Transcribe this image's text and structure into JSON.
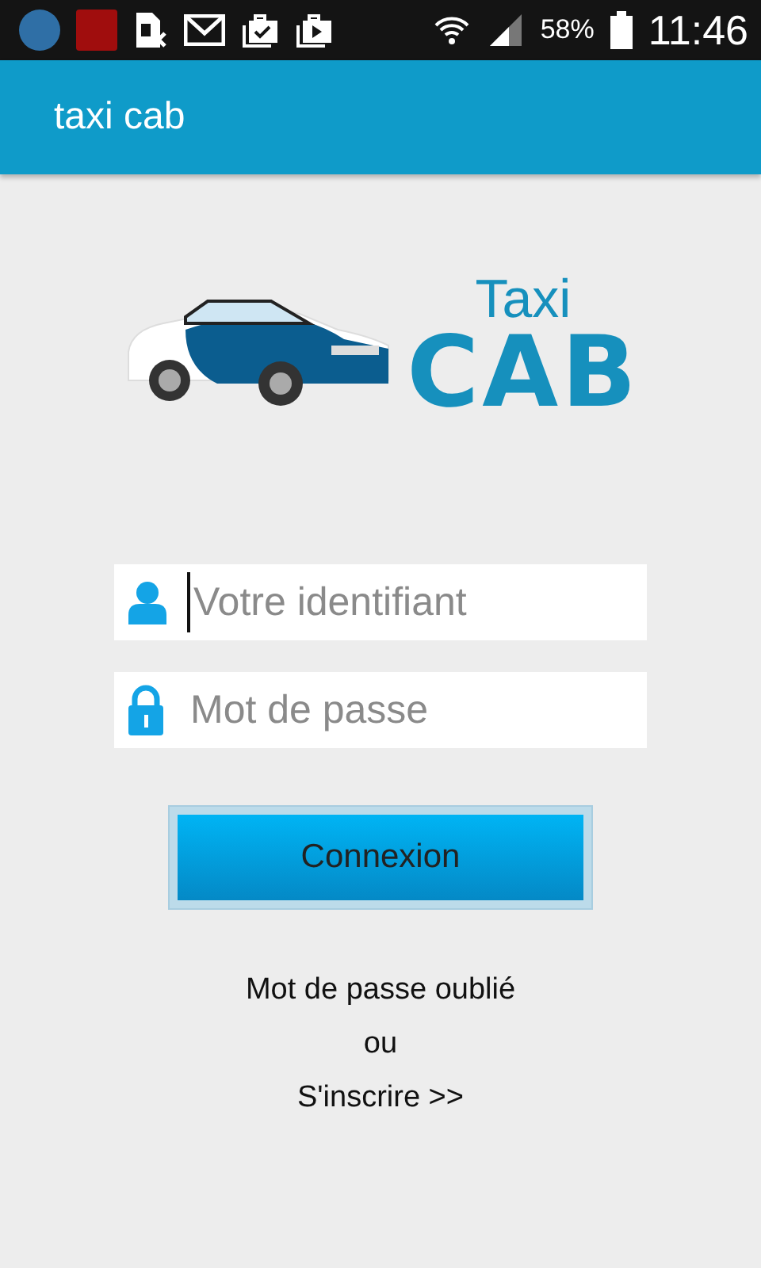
{
  "status_bar": {
    "battery": "58%",
    "time": "11:46"
  },
  "app_bar": {
    "title": "taxi cab"
  },
  "logo": {
    "line_1": "Taxi",
    "line_2": "CAB"
  },
  "fields": [
    {
      "kind": "user",
      "placeholder": "Votre identifiant",
      "focused": true
    },
    {
      "kind": "password",
      "placeholder": "Mot de passe",
      "focused": false
    }
  ],
  "login_button": {
    "label": "Connexion"
  },
  "links": [
    "Mot de passe oublié",
    "ou",
    "S'inscrire >>"
  ]
}
